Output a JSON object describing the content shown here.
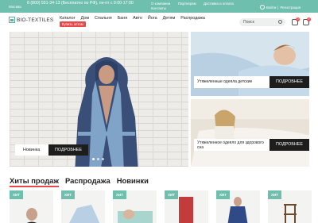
{
  "topbar": {
    "city": "Москва",
    "phone": "8 (800) 551-34-13 (Бесплатно по РФ), пн-пт с 9:00-17:00",
    "links": [
      "О компании",
      "Партнерам",
      "Доставка и оплата",
      "Контакты"
    ],
    "login": "Войти",
    "register": "Регистрация",
    "bg_color": "#6fbfae"
  },
  "header": {
    "logo": "BIO-TEXTILES",
    "nav": [
      "Каталог",
      "Дом",
      "Спальня",
      "Баня",
      "Авто",
      "Йога",
      "Детям",
      "Распродажа"
    ],
    "promo": "Купить оптом",
    "search_placeholder": "Поиск",
    "cart_count": "0",
    "fav_count": "0"
  },
  "hero": {
    "label": "Новинка",
    "button": "ПОДРОБНЕЕ",
    "slides": 3,
    "active_slide": 1
  },
  "cards": [
    {
      "label": "Утяжеленные одеяла детские",
      "button": "ПОДРОБНЕЕ"
    },
    {
      "label": "Утяжеленное одеяло для здорового сна",
      "button": "ПОДРОБНЕЕ"
    }
  ],
  "tabs": [
    "Хиты продаж",
    "Распродажа",
    "Новинки"
  ],
  "products": [
    {
      "badge": "ХИТ"
    },
    {
      "badge": "ХИТ"
    },
    {
      "badge": "ХИТ"
    },
    {
      "badge": "ХИТ"
    },
    {
      "badge": "ХИТ"
    },
    {
      "badge": "ХИТ"
    }
  ],
  "colors": {
    "accent": "#e8484a",
    "brand": "#6fbfae",
    "dark": "#1d1d1d"
  }
}
